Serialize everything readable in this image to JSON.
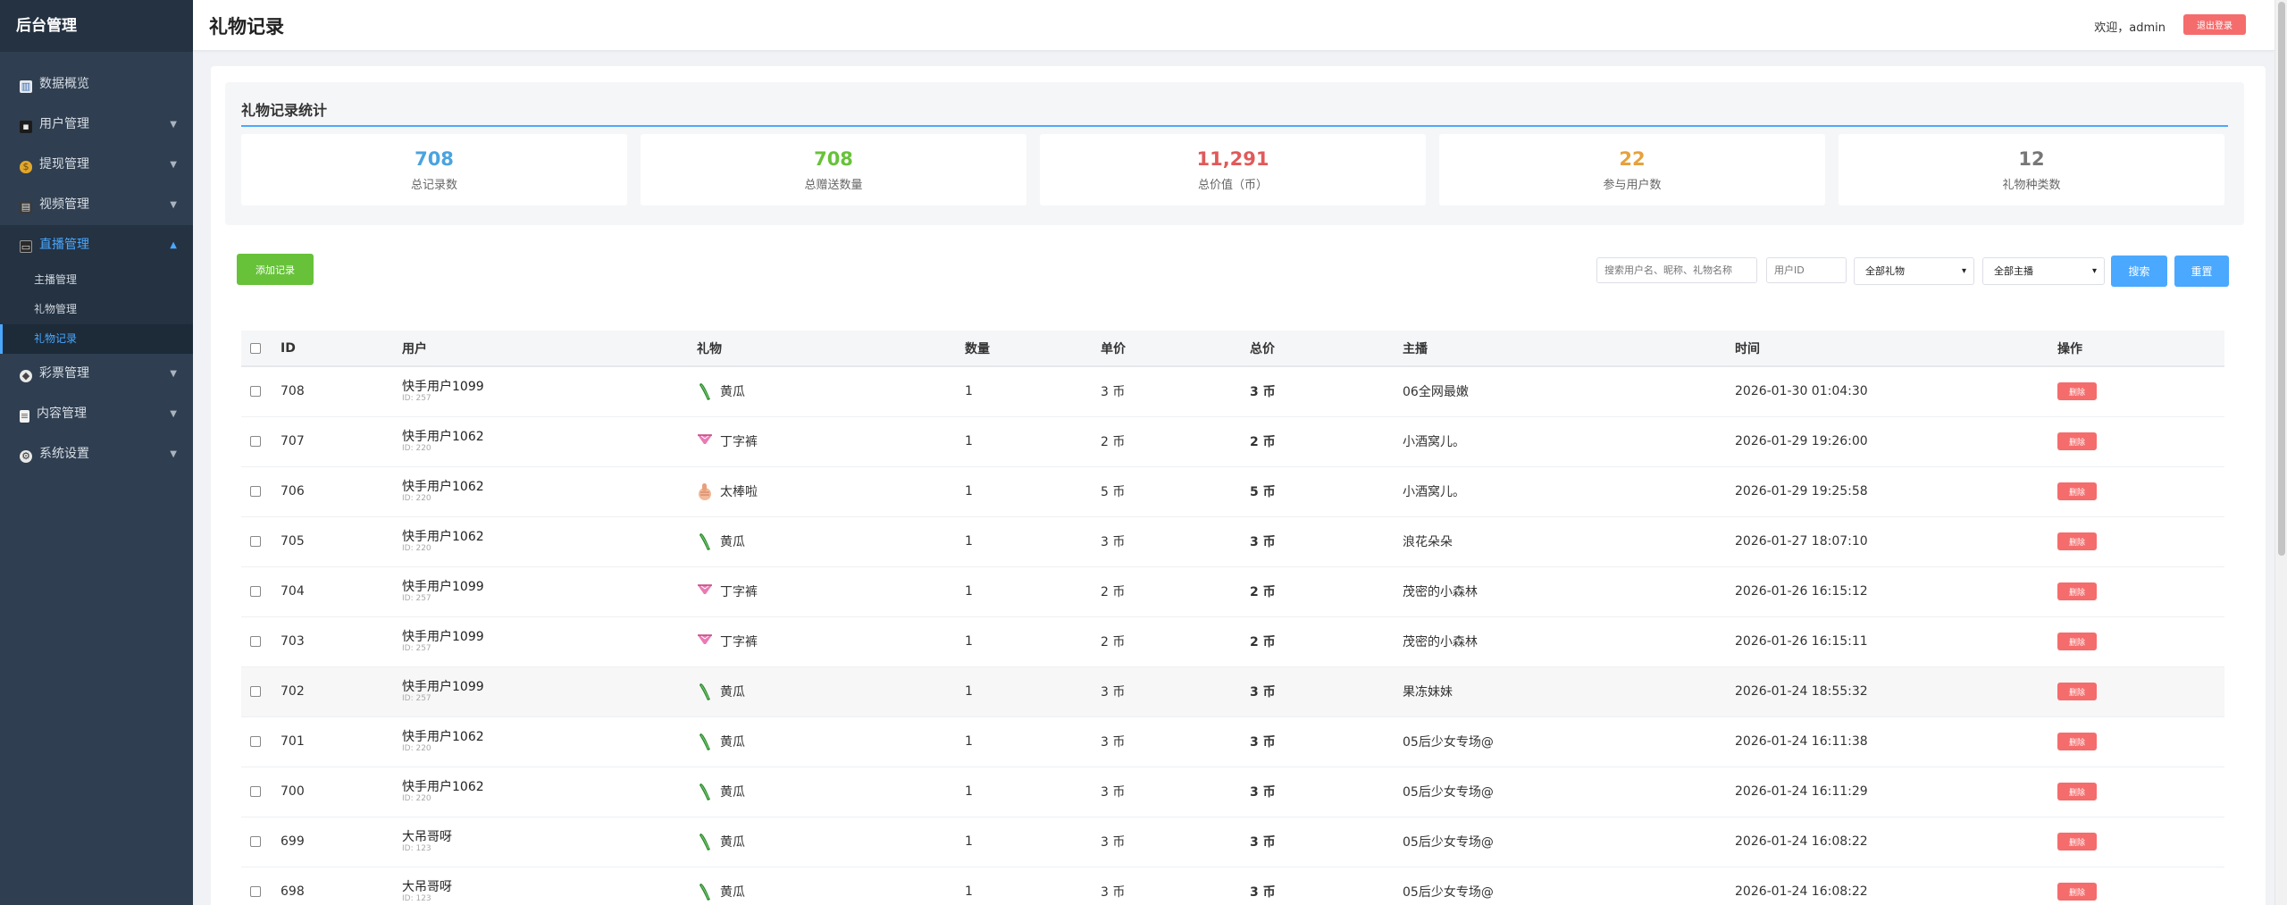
{
  "sidebar": {
    "brand": "后台管理",
    "items": [
      {
        "label": "数据概览",
        "icon": "chart-icon"
      },
      {
        "label": "用户管理",
        "icon": "users-icon"
      },
      {
        "label": "提现管理",
        "icon": "money-bag-icon"
      },
      {
        "label": "视频管理",
        "icon": "film-icon"
      },
      {
        "label": "直播管理",
        "icon": "tv-icon"
      },
      {
        "label": "彩票管理",
        "icon": "lottery-icon"
      },
      {
        "label": "内容管理",
        "icon": "document-icon"
      },
      {
        "label": "系统设置",
        "icon": "gear-icon"
      }
    ],
    "sub_items": [
      "主播管理",
      "礼物管理",
      "礼物记录"
    ]
  },
  "header": {
    "title": "礼物记录",
    "welcome": "欢迎，admin",
    "logout_label": "退出登录"
  },
  "stats": {
    "title": "礼物记录统计",
    "cards": [
      {
        "value": "708",
        "label": "总记录数",
        "color": "#4aa3df"
      },
      {
        "value": "708",
        "label": "总赠送数量",
        "color": "#67c23a"
      },
      {
        "value": "11,291",
        "label": "总价值（币）",
        "color": "#e05a5a"
      },
      {
        "value": "22",
        "label": "参与用户数",
        "color": "#e6a23c"
      },
      {
        "value": "12",
        "label": "礼物种类数",
        "color": "#777777"
      }
    ]
  },
  "toolbar": {
    "add_label": "添加记录",
    "search_placeholder": "搜索用户名、昵称、礼物名称",
    "uid_placeholder": "用户ID",
    "gift_select": "全部礼物",
    "anchor_select": "全部主播",
    "search_label": "搜索",
    "reset_label": "重置"
  },
  "table": {
    "headers": [
      "ID",
      "用户",
      "礼物",
      "数量",
      "单价",
      "总价",
      "主播",
      "时间",
      "操作"
    ],
    "delete_label": "删除",
    "rows": [
      {
        "id": "708",
        "user": "快手用户1099",
        "uid": "ID: 257",
        "gift": "黄瓜",
        "icon": "cucumber",
        "qty": "1",
        "unit": "3 币",
        "total": "3 币",
        "anchor": "06全网最嫩",
        "time": "2026-01-30 01:04:30"
      },
      {
        "id": "707",
        "user": "快手用户1062",
        "uid": "ID: 220",
        "gift": "丁字裤",
        "icon": "thong",
        "qty": "1",
        "unit": "2 币",
        "total": "2 币",
        "anchor": "小酒窝儿。",
        "time": "2026-01-29 19:26:00"
      },
      {
        "id": "706",
        "user": "快手用户1062",
        "uid": "ID: 220",
        "gift": "太棒啦",
        "icon": "thumbs-up",
        "qty": "1",
        "unit": "5 币",
        "total": "5 币",
        "anchor": "小酒窝儿。",
        "time": "2026-01-29 19:25:58"
      },
      {
        "id": "705",
        "user": "快手用户1062",
        "uid": "ID: 220",
        "gift": "黄瓜",
        "icon": "cucumber",
        "qty": "1",
        "unit": "3 币",
        "total": "3 币",
        "anchor": "浪花朵朵",
        "time": "2026-01-27 18:07:10"
      },
      {
        "id": "704",
        "user": "快手用户1099",
        "uid": "ID: 257",
        "gift": "丁字裤",
        "icon": "thong",
        "qty": "1",
        "unit": "2 币",
        "total": "2 币",
        "anchor": "茂密的小森林",
        "time": "2026-01-26 16:15:12"
      },
      {
        "id": "703",
        "user": "快手用户1099",
        "uid": "ID: 257",
        "gift": "丁字裤",
        "icon": "thong",
        "qty": "1",
        "unit": "2 币",
        "total": "2 币",
        "anchor": "茂密的小森林",
        "time": "2026-01-26 16:15:11"
      },
      {
        "id": "702",
        "user": "快手用户1099",
        "uid": "ID: 257",
        "gift": "黄瓜",
        "icon": "cucumber",
        "qty": "1",
        "unit": "3 币",
        "total": "3 币",
        "anchor": "果冻妹妹",
        "time": "2026-01-24 18:55:32"
      },
      {
        "id": "701",
        "user": "快手用户1062",
        "uid": "ID: 220",
        "gift": "黄瓜",
        "icon": "cucumber",
        "qty": "1",
        "unit": "3 币",
        "total": "3 币",
        "anchor": "05后少女专场@",
        "time": "2026-01-24 16:11:38"
      },
      {
        "id": "700",
        "user": "快手用户1062",
        "uid": "ID: 220",
        "gift": "黄瓜",
        "icon": "cucumber",
        "qty": "1",
        "unit": "3 币",
        "total": "3 币",
        "anchor": "05后少女专场@",
        "time": "2026-01-24 16:11:29"
      },
      {
        "id": "699",
        "user": "大吊哥呀",
        "uid": "ID: 123",
        "gift": "黄瓜",
        "icon": "cucumber",
        "qty": "1",
        "unit": "3 币",
        "total": "3 币",
        "anchor": "05后少女专场@",
        "time": "2026-01-24 16:08:22"
      },
      {
        "id": "698",
        "user": "大吊哥呀",
        "uid": "ID: 123",
        "gift": "黄瓜",
        "icon": "cucumber",
        "qty": "1",
        "unit": "3 币",
        "total": "3 币",
        "anchor": "05后少女专场@",
        "time": "2026-01-24 16:08:22"
      }
    ]
  }
}
